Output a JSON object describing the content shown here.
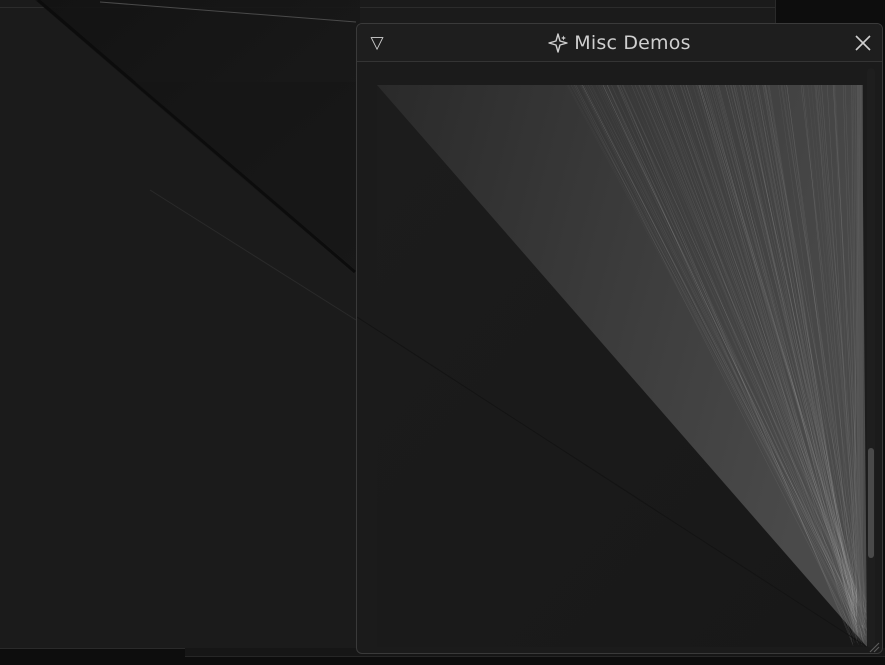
{
  "window": {
    "title": "Misc Demos",
    "title_icon": "sparkle-icon",
    "collapse_icon": "triangle-down-icon",
    "close_icon": "close-icon"
  },
  "colors": {
    "window_bg": "#1b1b1b",
    "titlebar_bg": "#1e1e1e",
    "border": "#3a3a3a",
    "text": "#cfcfcf",
    "line_stroke": "#bdbdbd"
  }
}
